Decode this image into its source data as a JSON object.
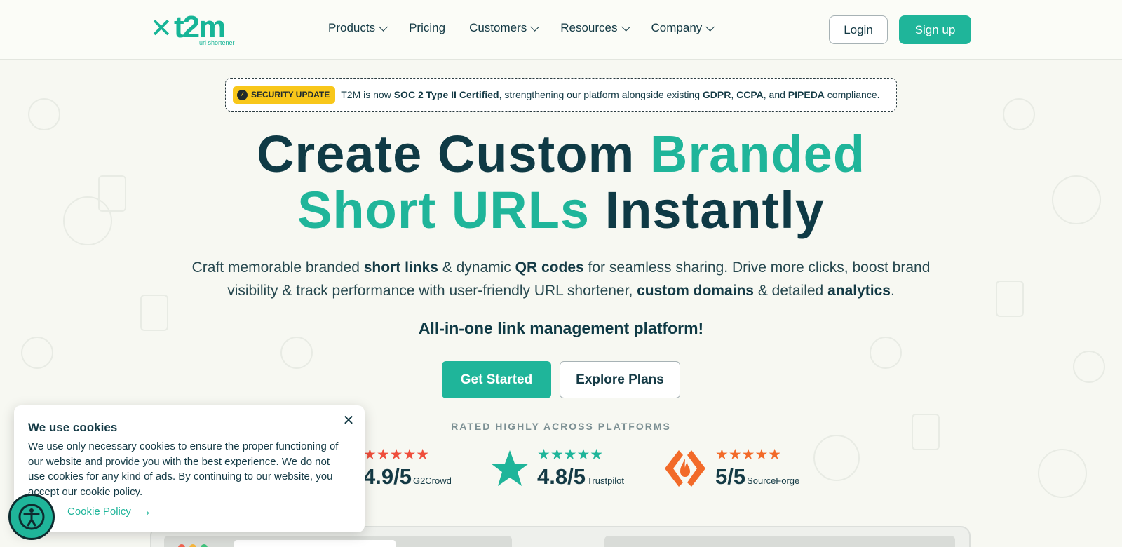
{
  "brand": {
    "logo_text": "t2m",
    "logo_sub": "url shortener",
    "accent_color": "#1fb59a",
    "dark_color": "#0f3a45"
  },
  "nav": {
    "items": [
      {
        "label": "Products",
        "has_dropdown": true
      },
      {
        "label": "Pricing",
        "has_dropdown": false
      },
      {
        "label": "Customers",
        "has_dropdown": true
      },
      {
        "label": "Resources",
        "has_dropdown": true
      },
      {
        "label": "Company",
        "has_dropdown": true
      }
    ],
    "login_label": "Login",
    "signup_label": "Sign up"
  },
  "announcement": {
    "badge": "SECURITY UPDATE",
    "text_1": "T2M is now ",
    "bold_1": "SOC 2 Type II Certified",
    "text_2": ", strengthening our platform alongside existing ",
    "bold_2": "GDPR",
    "text_3": ", ",
    "bold_3": "CCPA",
    "text_4": ", and ",
    "bold_4": "PIPEDA",
    "text_5": " compliance."
  },
  "hero": {
    "line1_dark": "Create Custom ",
    "line1_green": "Branded",
    "line2_green": "Short URLs",
    "line2_dark": " Instantly",
    "sub_1": "Craft memorable branded ",
    "sub_b1": "short links",
    "sub_2": " & dynamic ",
    "sub_b2": "QR codes",
    "sub_3": " for seamless sharing. Drive more clicks, boost brand visibility & track performance with user-friendly URL shortener, ",
    "sub_b3": "custom domains",
    "sub_4": " & detailed ",
    "sub_b4": "analytics",
    "sub_5": ".",
    "tagline": "All-in-one link management platform!",
    "cta_primary": "Get Started",
    "cta_secondary": "Explore Plans"
  },
  "ratings": {
    "heading": "RATED HIGHLY ACROSS PLATFORMS",
    "items": [
      {
        "score": "4.9/5",
        "source": "G2Crowd",
        "stars": 4.9,
        "color": "#ef4e3c"
      },
      {
        "score": "4.8/5",
        "source": "Trustpilot",
        "stars": 4.8,
        "color": "#1fb59a"
      },
      {
        "score": "5/5",
        "source": "SourceForge",
        "stars": 5,
        "color": "#f26a29"
      }
    ]
  },
  "cookie": {
    "title": "We use cookies",
    "body": "We use only necessary cookies to ensure the proper functioning of our website and provide you with the best experience. We do not use cookies for any kind of ads. By continuing to our website, you accept our cookie policy.",
    "policy_link": "Cookie Policy"
  }
}
